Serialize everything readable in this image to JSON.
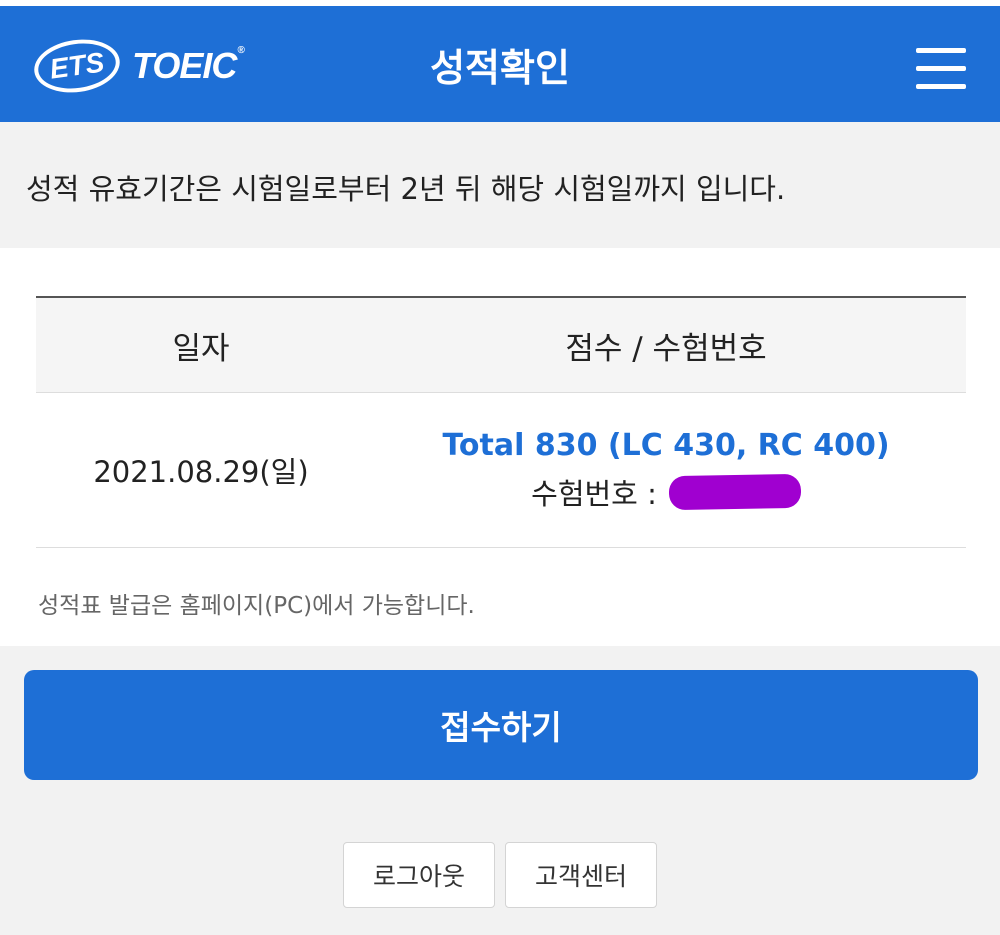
{
  "header": {
    "logo_ets": "ETS",
    "logo_toeic": "TOEIC",
    "title": "성적확인",
    "menu_icon": "hamburger-menu-icon"
  },
  "notice": {
    "text": "성적 유효기간은 시험일로부터 2년 뒤 해당 시험일까지 입니다."
  },
  "table": {
    "headers": {
      "date": "일자",
      "score": "점수 / 수험번호"
    },
    "rows": [
      {
        "date": "2021.08.29(일)",
        "score": "Total 830 (LC 430, RC 400)",
        "exam_label": "수험번호 :"
      }
    ]
  },
  "footnote": "성적표 발급은 홈페이지(PC)에서 가능합니다.",
  "buttons": {
    "apply": "접수하기",
    "logout": "로그아웃",
    "customer_center": "고객센터"
  },
  "colors": {
    "brand_blue": "#1e6fd6",
    "redaction": "#a000d0"
  }
}
